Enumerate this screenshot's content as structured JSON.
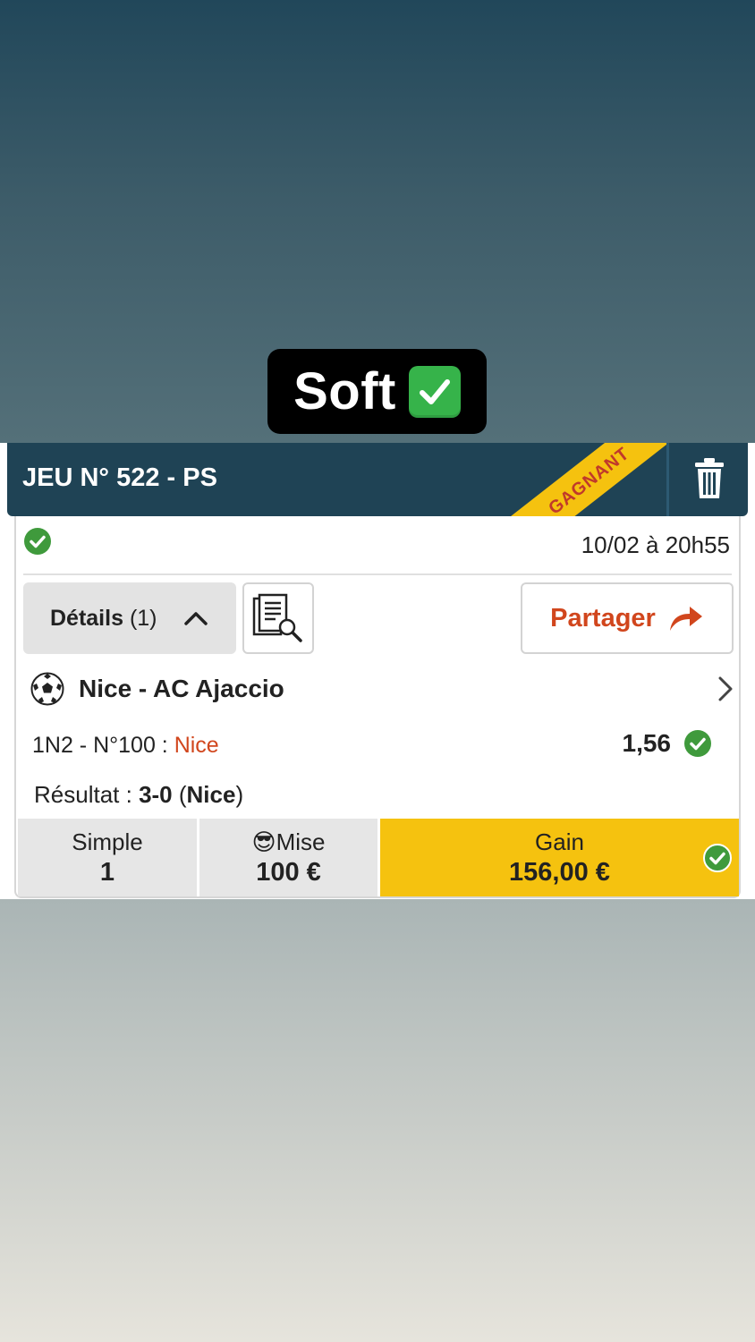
{
  "caption": {
    "text": "Soft",
    "badge_icon": "check-mark-button-icon"
  },
  "ticket": {
    "title": "JEU N° 522 - PS",
    "ribbon": "GAGNANT",
    "date": "10/02 à 20h55",
    "details_label": "Détails",
    "details_count": "(1)",
    "share_label": "Partager",
    "match": "Nice - AC Ajaccio",
    "bet_type": "1N2 - N°100 : ",
    "bet_pick": "Nice",
    "odds": "1,56",
    "result_prefix": "Résultat : ",
    "result_score": "3-0",
    "result_team": "Nice",
    "summary": {
      "type_label": "Simple",
      "type_value": "1",
      "stake_emoji": "😎",
      "stake_label": "Mise",
      "stake_value": "100 €",
      "gain_label": "Gain",
      "gain_value": "156,00 €"
    }
  },
  "colors": {
    "header_bg": "#1f4355",
    "ribbon": "#f5c20f",
    "accent_orange": "#d1461d",
    "success_green": "#3f9a3c",
    "gain_bg": "#f5c20f"
  }
}
